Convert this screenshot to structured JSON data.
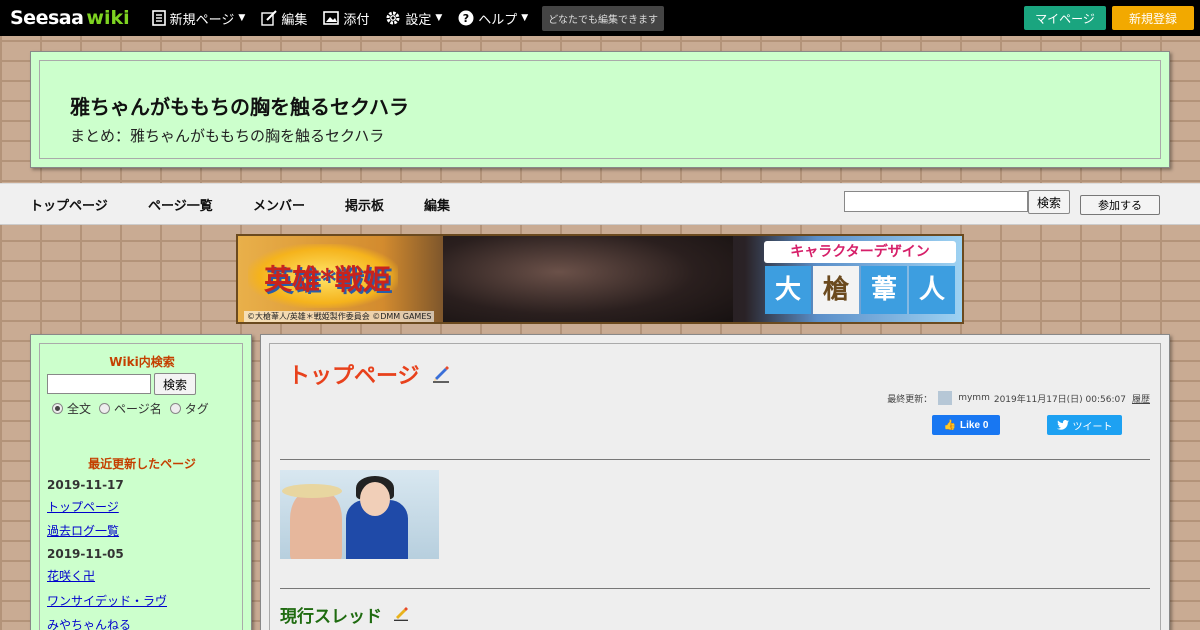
{
  "header": {
    "logo_main": "Seesaa",
    "logo_wiki": "wiki",
    "nav": [
      {
        "label": "新規ページ",
        "icon": "page-icon",
        "caret": true
      },
      {
        "label": "編集",
        "icon": "edit-icon",
        "caret": false
      },
      {
        "label": "添付",
        "icon": "image-icon",
        "caret": false
      },
      {
        "label": "設定",
        "icon": "gear-icon",
        "caret": true
      },
      {
        "label": "ヘルプ",
        "icon": "help-icon",
        "caret": true
      }
    ],
    "badge": "どなたでも編集できます",
    "mypage": "マイページ",
    "register": "新規登録",
    "colors": {
      "mypage": "#1aa57f",
      "register": "#f2a900",
      "logo_wiki": "#7ed321"
    }
  },
  "banner": {
    "title": "雅ちゃんがももちの胸を触るセクハラ",
    "subtitle": "まとめ：雅ちゃんがももちの胸を触るセクハラ"
  },
  "globalnav": {
    "links": [
      "トップページ",
      "ページ一覧",
      "メンバー",
      "掲示板",
      "編集"
    ],
    "search_button": "検索",
    "join_button": "参加する"
  },
  "ad": {
    "logo_text": "英雄*戦姫",
    "heading": "キャラクターデザイン",
    "name_chars": [
      "大",
      "槍",
      "葦",
      "人"
    ],
    "copyright": "©大槍葦人/英雄＊戦姫製作委員会 ©DMM GAMES"
  },
  "sidebar": {
    "search_heading": "Wiki内検索",
    "search_button": "検索",
    "radios": [
      {
        "label": "全文",
        "checked": true
      },
      {
        "label": "ページ名",
        "checked": false
      },
      {
        "label": "タグ",
        "checked": false
      }
    ],
    "recent_heading": "最近更新したページ",
    "recent": [
      {
        "date": "2019-11-17",
        "pages": [
          "トップページ",
          "過去ログ一覧"
        ]
      },
      {
        "date": "2019-11-05",
        "pages": [
          "花咲く卍",
          "ワンサイデッド・ラヴ",
          "みやちゃんねる"
        ]
      }
    ]
  },
  "main": {
    "page_title": "トップページ",
    "lastmod_label": "最終更新：",
    "lastmod_user": "mymm",
    "lastmod_date": "2019年11月17日(日) 00:56:07",
    "history": "履歴",
    "like": "Like 0",
    "tweet": "ツイート",
    "section_title": "現行スレッド"
  }
}
